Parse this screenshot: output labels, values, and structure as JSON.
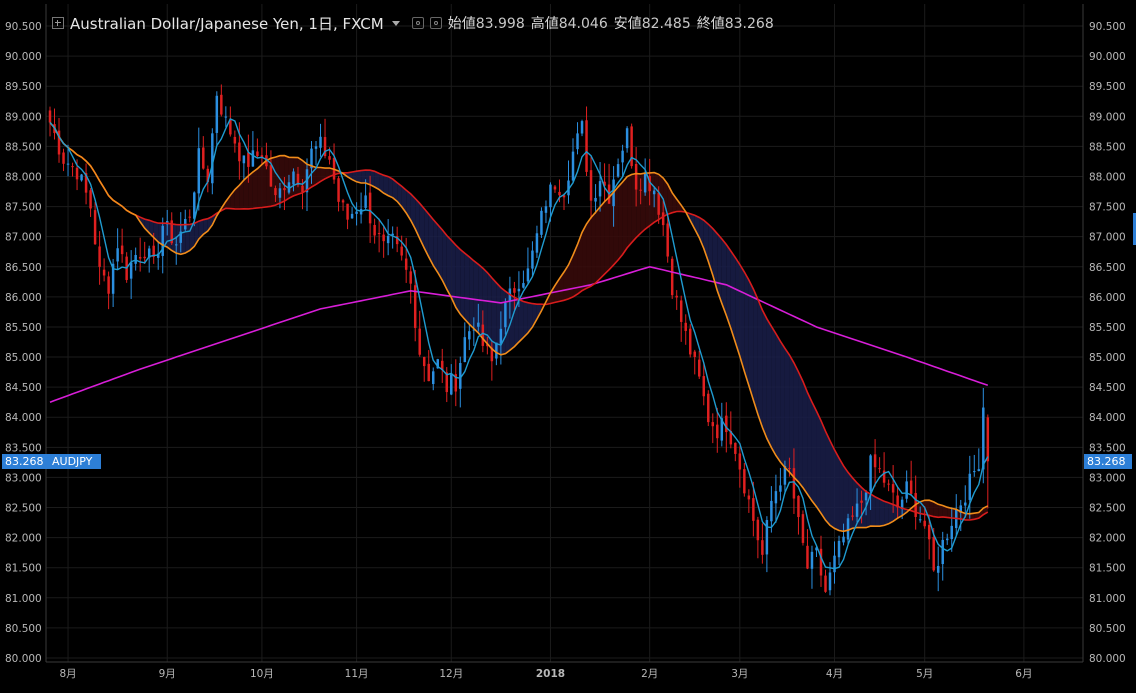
{
  "header": {
    "title": "Australian Dollar/Japanese Yen, 1日, FXCM",
    "open_label": "始値",
    "open_value": "83.998",
    "high_label": "高値",
    "high_value": "84.046",
    "low_label": "安値",
    "low_value": "82.485",
    "close_label": "終値",
    "close_value": "83.268"
  },
  "price_tag": {
    "value": "83.268",
    "symbol": "AUDJPY",
    "color": "#2d7fd7"
  },
  "colors": {
    "background": "#000000",
    "grid": "#1b1b1b",
    "axis_text": "#b8b8b8",
    "up": "#2b8fe0",
    "down": "#e02020",
    "ma_fast": "#1f9bd0",
    "ma_mid": "#f08c1a",
    "ma_slow": "#d81c1c",
    "ma_long": "#d81ed8",
    "cloud_bear": "#1a1f4a",
    "cloud_bull": "#3a0b0b"
  },
  "chart_data": {
    "type": "candlestick",
    "title": "Australian Dollar/Japanese Yen, 1日, FXCM",
    "ylim": [
      80.0,
      90.5
    ],
    "y_ticks": [
      "90.500",
      "90.000",
      "89.500",
      "89.000",
      "88.500",
      "88.000",
      "87.500",
      "87.000",
      "86.500",
      "86.000",
      "85.500",
      "85.000",
      "84.500",
      "84.000",
      "83.500",
      "83.000",
      "82.500",
      "82.000",
      "81.500",
      "81.000",
      "80.500",
      "80.000"
    ],
    "x_ticks": [
      {
        "label": "8月",
        "index": 4
      },
      {
        "label": "9月",
        "index": 26
      },
      {
        "label": "10月",
        "index": 47
      },
      {
        "label": "11月",
        "index": 68
      },
      {
        "label": "12月",
        "index": 89
      },
      {
        "label": "2018",
        "index": 111
      },
      {
        "label": "2月",
        "index": 133
      },
      {
        "label": "3月",
        "index": 153
      },
      {
        "label": "4月",
        "index": 174
      },
      {
        "label": "5月",
        "index": 194
      },
      {
        "label": "6月",
        "index": 216
      }
    ],
    "n_slots": 230,
    "close_anchors": [
      [
        0,
        88.9
      ],
      [
        3,
        88.3
      ],
      [
        6,
        88.1
      ],
      [
        9,
        87.5
      ],
      [
        11,
        86.4
      ],
      [
        13,
        86.2
      ],
      [
        15,
        86.9
      ],
      [
        17,
        86.4
      ],
      [
        19,
        86.7
      ],
      [
        21,
        86.8
      ],
      [
        23,
        86.5
      ],
      [
        25,
        87.2
      ],
      [
        28,
        86.9
      ],
      [
        31,
        87.4
      ],
      [
        33,
        88.3
      ],
      [
        35,
        88.0
      ],
      [
        37,
        89.4
      ],
      [
        39,
        88.9
      ],
      [
        41,
        88.6
      ],
      [
        43,
        88.2
      ],
      [
        45,
        88.3
      ],
      [
        47,
        88.4
      ],
      [
        50,
        87.6
      ],
      [
        52,
        87.9
      ],
      [
        54,
        88.1
      ],
      [
        56,
        87.9
      ],
      [
        58,
        88.4
      ],
      [
        60,
        88.5
      ],
      [
        62,
        88.3
      ],
      [
        64,
        87.6
      ],
      [
        66,
        87.3
      ],
      [
        68,
        87.5
      ],
      [
        70,
        87.6
      ],
      [
        72,
        87.1
      ],
      [
        74,
        86.8
      ],
      [
        76,
        86.9
      ],
      [
        78,
        86.6
      ],
      [
        80,
        86.2
      ],
      [
        82,
        85.1
      ],
      [
        84,
        84.7
      ],
      [
        86,
        84.9
      ],
      [
        88,
        84.5
      ],
      [
        90,
        84.6
      ],
      [
        92,
        85.3
      ],
      [
        94,
        85.6
      ],
      [
        96,
        85.2
      ],
      [
        98,
        84.9
      ],
      [
        100,
        85.6
      ],
      [
        102,
        86.0
      ],
      [
        104,
        86.3
      ],
      [
        106,
        86.4
      ],
      [
        108,
        87.0
      ],
      [
        110,
        87.6
      ],
      [
        112,
        87.9
      ],
      [
        114,
        87.8
      ],
      [
        116,
        88.4
      ],
      [
        118,
        88.8
      ],
      [
        120,
        87.6
      ],
      [
        122,
        88.0
      ],
      [
        124,
        87.7
      ],
      [
        126,
        88.3
      ],
      [
        128,
        88.7
      ],
      [
        130,
        87.9
      ],
      [
        132,
        88.0
      ],
      [
        134,
        87.8
      ],
      [
        136,
        87.2
      ],
      [
        138,
        86.2
      ],
      [
        140,
        85.6
      ],
      [
        142,
        85.1
      ],
      [
        144,
        84.6
      ],
      [
        146,
        84.0
      ],
      [
        148,
        83.8
      ],
      [
        150,
        83.9
      ],
      [
        152,
        83.5
      ],
      [
        154,
        82.9
      ],
      [
        156,
        82.3
      ],
      [
        158,
        81.7
      ],
      [
        160,
        82.6
      ],
      [
        162,
        83.0
      ],
      [
        164,
        83.1
      ],
      [
        166,
        82.2
      ],
      [
        168,
        81.5
      ],
      [
        170,
        81.7
      ],
      [
        172,
        81.1
      ],
      [
        174,
        81.6
      ],
      [
        176,
        82.0
      ],
      [
        178,
        82.3
      ],
      [
        180,
        82.6
      ],
      [
        182,
        83.2
      ],
      [
        184,
        83.1
      ],
      [
        186,
        82.8
      ],
      [
        188,
        82.5
      ],
      [
        190,
        82.8
      ],
      [
        192,
        82.5
      ],
      [
        194,
        82.2
      ],
      [
        196,
        81.4
      ],
      [
        198,
        81.9
      ],
      [
        200,
        82.3
      ],
      [
        202,
        82.6
      ],
      [
        204,
        82.9
      ],
      [
        206,
        83.3
      ],
      [
        207,
        84.2
      ],
      [
        208,
        83.268
      ]
    ],
    "last_index": 208,
    "series": [
      {
        "name": "",
        "type": "ma",
        "period": 5
      },
      {
        "name": "",
        "type": "ma",
        "period": 20
      },
      {
        "name": "",
        "type": "ma",
        "period": 40
      },
      {
        "name": "",
        "type": "ma",
        "period": 150
      }
    ],
    "grid": true
  }
}
